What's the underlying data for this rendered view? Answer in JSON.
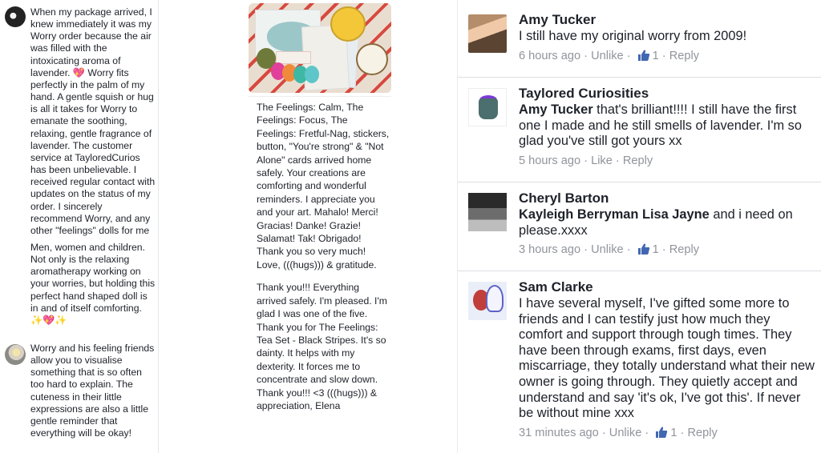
{
  "left_column": {
    "posts": [
      {
        "paragraphs": [
          "When my package arrived, I knew immediately it was my Worry order because the air was filled with the intoxicating aroma of lavender. 💖 Worry fits perfectly in the palm of my hand. A gentle squish or hug is all it takes for Worry to emanate the soothing, relaxing, gentle fragrance of lavender. The customer service at TayloredCurios has been unbelievable. I received regular  contact with updates on the status of my order. I sincerely recommend Worry, and any other \"feelings\" dolls for me",
          "Men, women and children. Not only is the relaxing aromatherapy working on your worries, but holding this perfect hand shaped doll is in and of itself comforting. ✨💖✨"
        ]
      },
      {
        "paragraphs": [
          "Worry and his feeling friends allow you to visualise something that is so often too hard to explain. The cuteness in their little expressions are also a little gentle reminder that everything will be okay!"
        ]
      }
    ]
  },
  "middle_column": {
    "paragraphs": [
      "The Feelings: Calm, The Feelings: Focus, The Feelings: Fretful-Nag, stickers, button, \"You're strong\" & \"Not Alone\" cards arrived home safely. Your creations are comforting and wonderful reminders. I appreciate you and your art. Mahalo! Merci! Gracias! Danke! Grazie! Salamat! Tak! Obrigado! Thank you so very much!  Love, (((hugs))) & gratitude.",
      "Thank you!!!  Everything arrived safely.  I'm pleased. I'm glad I was one of the five.  Thank you for The Feelings: Tea Set - Black Stripes.  It's so dainty.  It helps with my dexterity.  It forces me to concentrate and slow down.  Thank you!!!  <3 (((hugs))) & appreciation, Elena"
    ]
  },
  "comments": [
    {
      "name": "Amy Tucker",
      "mention": "",
      "text": "I still have my original worry from 2009!",
      "time": "6 hours ago",
      "action": "Unlike",
      "likes": "1",
      "reply": "Reply"
    },
    {
      "name": "Taylored Curiosities",
      "mention": "Amy Tucker",
      "text": " that's brilliant!!!! I still have the first one I made and he still smells of lavender. I'm so glad you've still got yours xx",
      "time": "5 hours ago",
      "action": "Like",
      "likes": "",
      "reply": "Reply"
    },
    {
      "name": "Cheryl Barton",
      "mention": "Kayleigh Berryman  Lisa Jayne",
      "text": " and i need on please.xxxx",
      "time": "3 hours ago",
      "action": "Unlike",
      "likes": "1",
      "reply": "Reply"
    },
    {
      "name": "Sam Clarke",
      "mention": "",
      "text": "I have several myself, I've gifted some more to friends and I can testify just how much they comfort and support through tough times. They have been through exams, first days, even miscarriage,  they totally understand what their new owner is going through. They quietly accept and understand and say 'it's ok, I've got this'. If never be without mine xxx",
      "time": "31 minutes ago",
      "action": "Unlike",
      "likes": "1",
      "reply": "Reply"
    }
  ],
  "meta_separator": " · ",
  "colors": {
    "meta": "#90949c",
    "like_blue": "#4267b2",
    "text": "#1d2129"
  },
  "icons": {
    "like": "thumbs-up-icon"
  }
}
